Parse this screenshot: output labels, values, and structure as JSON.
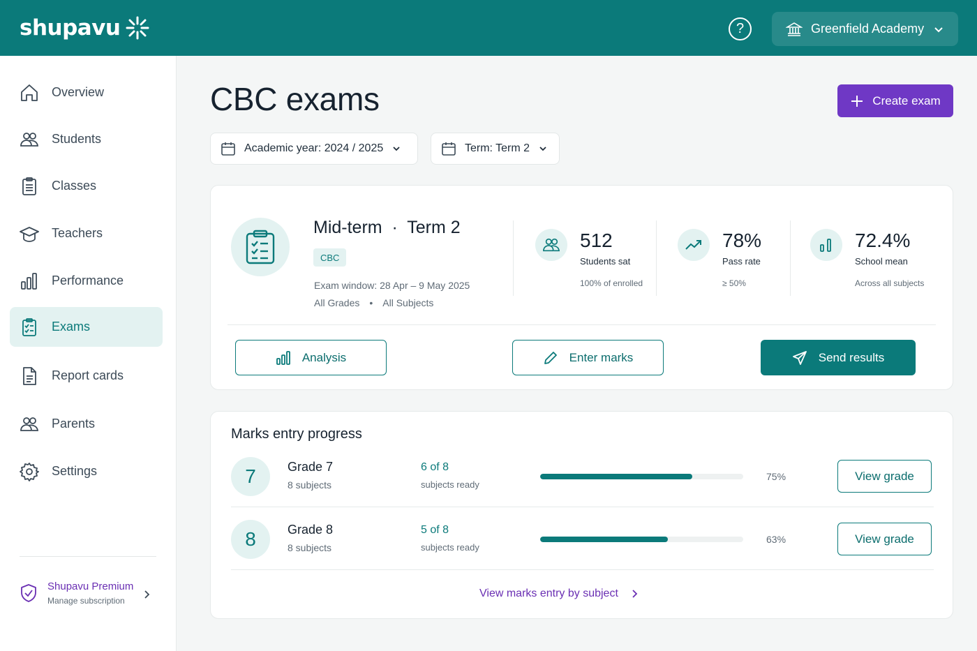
{
  "brand": {
    "name": "shupavu",
    "primary": "#0b7a7a",
    "accent": "#6f38c5"
  },
  "topbar": {
    "help_icon": "help-circle-icon",
    "school": "Greenfield Academy"
  },
  "sidebar": {
    "items": [
      {
        "label": "Overview",
        "icon": "home-icon"
      },
      {
        "label": "Students",
        "icon": "users-icon"
      },
      {
        "label": "Classes",
        "icon": "clipboard-list-icon"
      },
      {
        "label": "Teachers",
        "icon": "graduation-cap-icon"
      },
      {
        "label": "Performance",
        "icon": "bar-chart-icon"
      },
      {
        "label": "Exams",
        "icon": "clipboard-check-icon",
        "active": true
      },
      {
        "label": "Report cards",
        "icon": "document-icon"
      },
      {
        "label": "Parents",
        "icon": "users-icon"
      },
      {
        "label": "Settings",
        "icon": "gear-icon"
      }
    ],
    "premium": {
      "title": "Shupavu Premium",
      "subtitle": "Manage subscription"
    }
  },
  "page": {
    "title": "CBC exams",
    "create_label": "Create exam"
  },
  "filters": {
    "year": "Academic year: 2024 / 2025",
    "term": "Term: Term 2"
  },
  "exam": {
    "title": "Mid-term",
    "term": "Term 2",
    "badge": "CBC",
    "window": "Exam window: 28 Apr – 9 May 2025",
    "grades": "All Grades",
    "subjects": "All Subjects",
    "stats": [
      {
        "value": "512",
        "label": "Students sat",
        "note": "100% of enrolled"
      },
      {
        "value": "78%",
        "label": "Pass rate",
        "note": "≥ 50%"
      },
      {
        "value": "72.4%",
        "label": "School mean",
        "note": "Across all subjects"
      }
    ],
    "actions": {
      "analysis": "Analysis",
      "enter_marks": "Enter marks",
      "send_results": "Send results"
    }
  },
  "progress": {
    "title": "Marks entry progress",
    "rows": [
      {
        "num": "7",
        "name": "Grade 7",
        "subjects": "8 subjects",
        "ready": "6 of 8",
        "ready_sub": "subjects ready",
        "percent": 75,
        "pct_label": "75%",
        "button": "View grade"
      },
      {
        "num": "8",
        "name": "Grade 8",
        "subjects": "8 subjects",
        "ready": "5 of 8",
        "ready_sub": "subjects ready",
        "percent": 63,
        "pct_label": "63%",
        "button": "View grade"
      }
    ],
    "link": "View marks entry by subject"
  }
}
